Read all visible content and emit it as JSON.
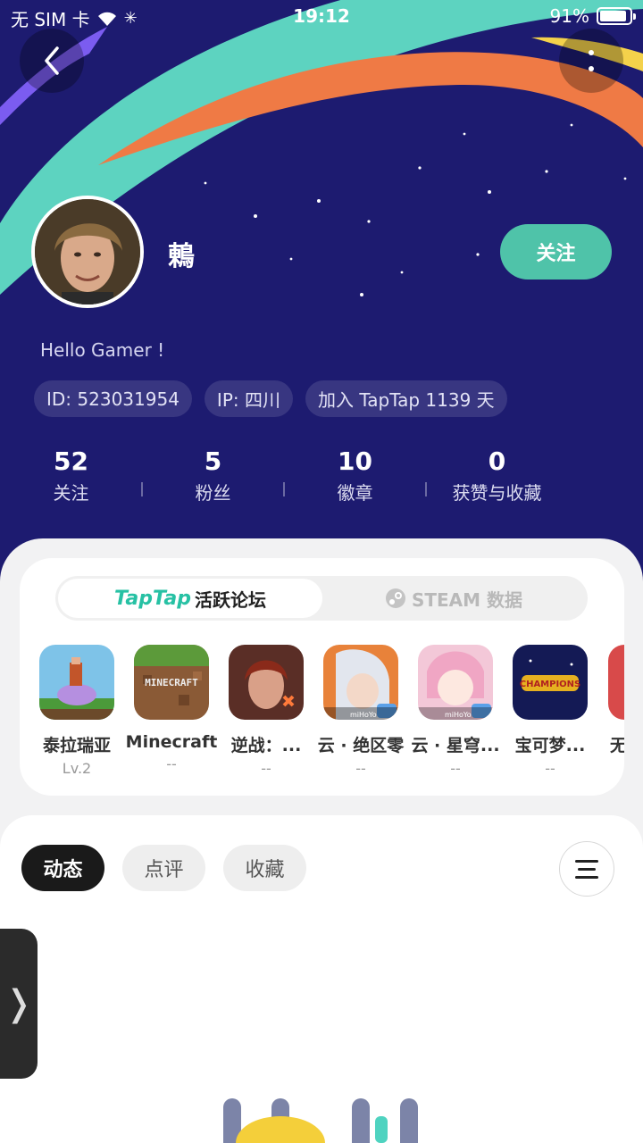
{
  "status_bar": {
    "carrier": "无 SIM 卡",
    "time": "19:12",
    "battery": "91%",
    "battery_level": 0.91
  },
  "profile": {
    "username": "鶇",
    "follow_label": "关注",
    "bio": "Hello Gamer !",
    "tags": [
      "ID: 523031954",
      "IP: 四川",
      "加入 TapTap 1139 天"
    ],
    "stats": [
      {
        "value": "52",
        "label": "关注"
      },
      {
        "value": "5",
        "label": "粉丝"
      },
      {
        "value": "10",
        "label": "徽章"
      },
      {
        "value": "0",
        "label": "获赞与收藏"
      }
    ]
  },
  "games_panel": {
    "tab_active_logo": "TapTap",
    "tab_active_label": "活跃论坛",
    "tab_inactive_label": "STEAM 数据",
    "games": [
      {
        "name": "泰拉瑞亚",
        "level": "Lv.2"
      },
      {
        "name": "Minecraft",
        "level": "--"
      },
      {
        "name": "逆战：...",
        "level": "--"
      },
      {
        "name": "云 · 绝区零",
        "level": "--"
      },
      {
        "name": "云 · 星穹...",
        "level": "--"
      },
      {
        "name": "宝可梦...",
        "level": "--"
      },
      {
        "name": "无",
        "level": ""
      }
    ]
  },
  "feed": {
    "tabs": [
      "动态",
      "点评",
      "收藏"
    ],
    "active_tab": "动态"
  },
  "colors": {
    "hero_bg": "#1d1b70",
    "accent": "#4fc3a9",
    "orange": "#ef7a45",
    "teal": "#5dd3c0"
  }
}
